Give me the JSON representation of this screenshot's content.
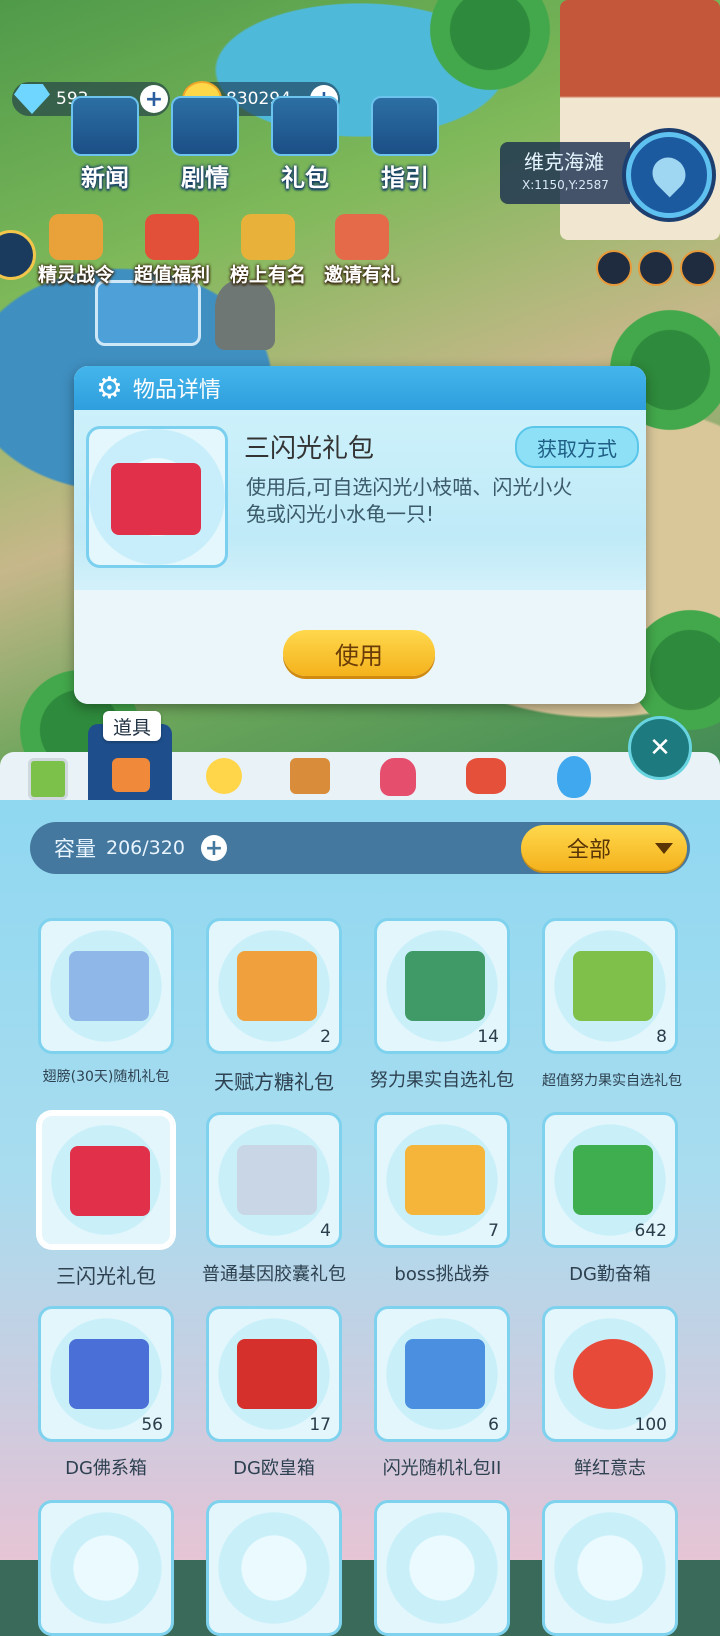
{
  "currency": {
    "gems": "593",
    "coins": "830294",
    "gem_icon": "diamond-icon",
    "coin_icon": "cat-coin-icon"
  },
  "top_menu": [
    {
      "label": "新闻",
      "icon": "news-icon"
    },
    {
      "label": "剧情",
      "icon": "story-icon"
    },
    {
      "label": "礼包",
      "icon": "gift-pack-icon"
    },
    {
      "label": "指引",
      "icon": "guide-icon"
    }
  ],
  "promo_menu": [
    {
      "label": "精灵战令",
      "icon": "battle-pass-icon"
    },
    {
      "label": "超值福利",
      "icon": "gift-icon"
    },
    {
      "label": "榜上有名",
      "icon": "trophy-icon"
    },
    {
      "label": "邀请有礼",
      "icon": "invite-icon"
    }
  ],
  "location": {
    "name": "维克海滩",
    "coords": "X:1150,Y:2587"
  },
  "popup": {
    "title": "物品详情",
    "item_name": "三闪光礼包",
    "item_desc": "使用后,可自选闪光小枝喵、闪光小火兔或闪光小水龟一只!",
    "get_button": "获取方式",
    "use_button": "使用"
  },
  "tabs": {
    "active_tooltip": "道具",
    "items": [
      "battery-icon",
      "props-icon",
      "candy-icon",
      "crown-icon",
      "dress-icon",
      "rocking-horse-icon",
      "egg-icon"
    ]
  },
  "inventory": {
    "capacity_label": "容量",
    "capacity_value": "206/320",
    "filter": "全部",
    "items": [
      {
        "name": "翅膀(30天)随机礼包",
        "count": "",
        "color": "#8fb7e8"
      },
      {
        "name": "天赋方糖礼包",
        "count": "2",
        "color": "#f0a03c"
      },
      {
        "name": "努力果实自选礼包",
        "count": "14",
        "color": "#3f9a67"
      },
      {
        "name": "超值努力果实自选礼包",
        "count": "8",
        "color": "#7ec04a"
      },
      {
        "name": "三闪光礼包",
        "count": "",
        "color": "#e0304a"
      },
      {
        "name": "普通基因胶囊礼包",
        "count": "4",
        "color": "#c9d6e6"
      },
      {
        "name": "boss挑战券",
        "count": "7",
        "color": "#f5b53b"
      },
      {
        "name": "DG勤奋箱",
        "count": "642",
        "color": "#3fae4f"
      },
      {
        "name": "DG佛系箱",
        "count": "56",
        "color": "#4a6fd6"
      },
      {
        "name": "DG欧皇箱",
        "count": "17",
        "color": "#d6302d"
      },
      {
        "name": "闪光随机礼包II",
        "count": "6",
        "color": "#4a8fe0"
      },
      {
        "name": "鲜红意志",
        "count": "100",
        "color": "#e84a3a"
      }
    ]
  }
}
